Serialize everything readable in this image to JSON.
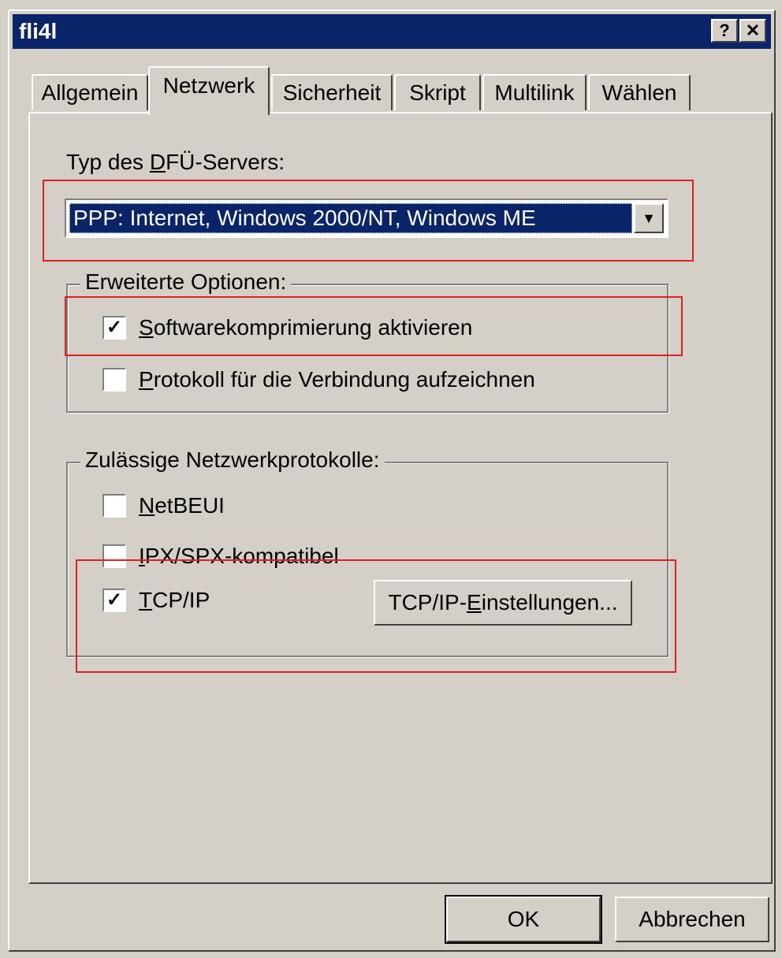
{
  "window": {
    "title": "fli4l",
    "help_label": "?",
    "close_label": "✕"
  },
  "tabs": [
    {
      "label": "Allgemein",
      "active": false
    },
    {
      "label": "Netzwerk",
      "active": true
    },
    {
      "label": "Sicherheit",
      "active": false
    },
    {
      "label": "Skript",
      "active": false
    },
    {
      "label": "Multilink",
      "active": false
    },
    {
      "label": "Wählen",
      "active": false
    }
  ],
  "server_type": {
    "label_pre": "Typ des ",
    "label_accel": "D",
    "label_post": "FÜ-Servers:",
    "selected": "PPP: Internet, Windows 2000/NT, Windows ME"
  },
  "advanced": {
    "legend": "Erweiterte Optionen:",
    "options": [
      {
        "accel": "S",
        "rest": "oftwarekomprimierung aktivieren",
        "checked": true
      },
      {
        "accel": "P",
        "rest": "rotokoll für die Verbindung aufzeichnen",
        "checked": false
      }
    ]
  },
  "protocols": {
    "legend": "Zulässige Netzwerkprotokolle:",
    "items": [
      {
        "accel": "N",
        "rest": "etBEUI",
        "checked": false
      },
      {
        "accel": "I",
        "rest": "PX/SPX-kompatibel",
        "checked": false
      },
      {
        "accel": "T",
        "rest": "CP/IP",
        "checked": true
      }
    ],
    "settings_button": {
      "pre": "TCP/IP-",
      "accel": "E",
      "post": "instellungen..."
    }
  },
  "buttons": {
    "ok": "OK",
    "cancel": "Abbrechen"
  },
  "colors": {
    "titlebar": "#0a246a",
    "dialog": "#d4d0c8",
    "highlight_box": "#e02020"
  }
}
